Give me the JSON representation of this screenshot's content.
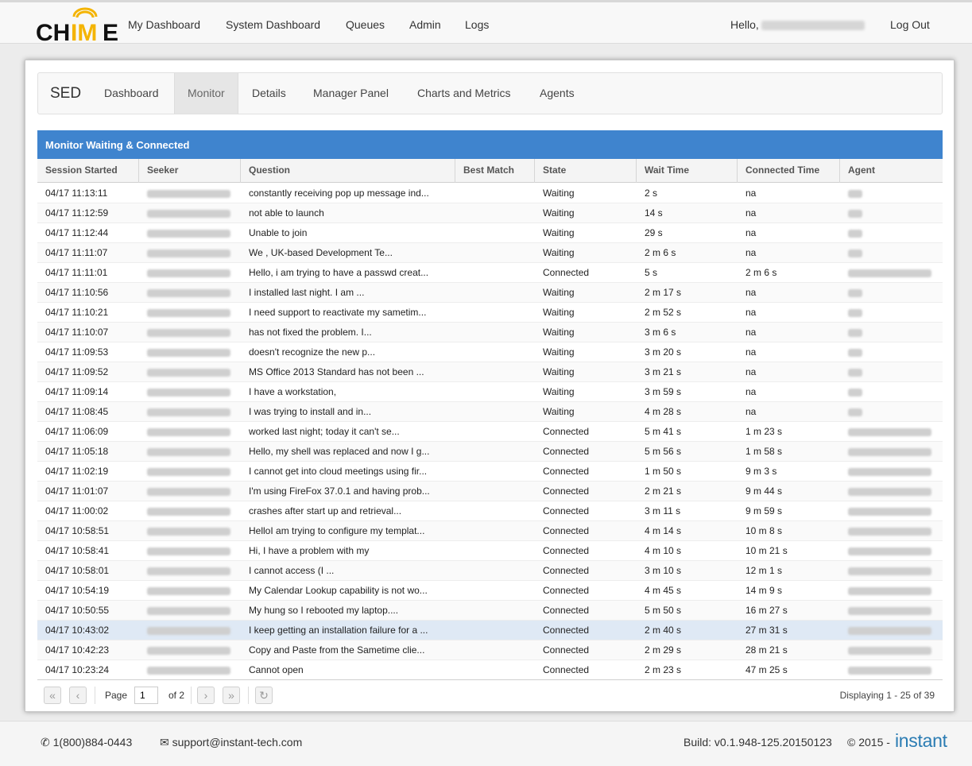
{
  "header": {
    "logo_text": "CHIME",
    "nav": [
      "My Dashboard",
      "System Dashboard",
      "Queues",
      "Admin",
      "Logs"
    ],
    "hello_label": "Hello,",
    "logout_label": "Log Out"
  },
  "subnav": {
    "brand": "SED",
    "tabs": [
      "Dashboard",
      "Monitor",
      "Details",
      "Manager Panel",
      "Charts and Metrics",
      "Agents"
    ],
    "active_tab": "Monitor"
  },
  "grid": {
    "title": "Monitor Waiting & Connected",
    "columns": [
      "Session Started",
      "Seeker",
      "Question",
      "Best Match",
      "State",
      "Wait Time",
      "Connected Time",
      "Agent"
    ],
    "rows": [
      {
        "started": "04/17 11:13:11",
        "question": "constantly receiving pop up message ind...",
        "best_match": "",
        "state": "Waiting",
        "wait": "2 s",
        "connected": "na"
      },
      {
        "started": "04/17 11:12:59",
        "question": "not able to launch",
        "best_match": "",
        "state": "Waiting",
        "wait": "14 s",
        "connected": "na"
      },
      {
        "started": "04/17 11:12:44",
        "question": "Unable to join",
        "best_match": "",
        "state": "Waiting",
        "wait": "29 s",
        "connected": "na"
      },
      {
        "started": "04/17 11:11:07",
        "question": "We , UK-based Development Te...",
        "best_match": "",
        "state": "Waiting",
        "wait": "2 m 6 s",
        "connected": "na"
      },
      {
        "started": "04/17 11:11:01",
        "question": "Hello, i am trying to have a passwd creat...",
        "best_match": "",
        "state": "Connected",
        "wait": "5 s",
        "connected": "2 m 6 s"
      },
      {
        "started": "04/17 11:10:56",
        "question": "I installed last night. I am ...",
        "best_match": "",
        "state": "Waiting",
        "wait": "2 m 17 s",
        "connected": "na"
      },
      {
        "started": "04/17 11:10:21",
        "question": "I need support to reactivate my sametim...",
        "best_match": "",
        "state": "Waiting",
        "wait": "2 m 52 s",
        "connected": "na"
      },
      {
        "started": "04/17 11:10:07",
        "question": "has not fixed the problem. I...",
        "best_match": "",
        "state": "Waiting",
        "wait": "3 m 6 s",
        "connected": "na"
      },
      {
        "started": "04/17 11:09:53",
        "question": "doesn't recognize the new p...",
        "best_match": "",
        "state": "Waiting",
        "wait": "3 m 20 s",
        "connected": "na"
      },
      {
        "started": "04/17 11:09:52",
        "question": "MS Office 2013 Standard has not been ...",
        "best_match": "",
        "state": "Waiting",
        "wait": "3 m 21 s",
        "connected": "na"
      },
      {
        "started": "04/17 11:09:14",
        "question": "I have a workstation,",
        "best_match": "",
        "state": "Waiting",
        "wait": "3 m 59 s",
        "connected": "na"
      },
      {
        "started": "04/17 11:08:45",
        "question": "I was trying to install and in...",
        "best_match": "",
        "state": "Waiting",
        "wait": "4 m 28 s",
        "connected": "na"
      },
      {
        "started": "04/17 11:06:09",
        "question": "worked last night; today it can't se...",
        "best_match": "",
        "state": "Connected",
        "wait": "5 m 41 s",
        "connected": "1 m 23 s"
      },
      {
        "started": "04/17 11:05:18",
        "question": "Hello, my shell was replaced and now I g...",
        "best_match": "",
        "state": "Connected",
        "wait": "5 m 56 s",
        "connected": "1 m 58 s"
      },
      {
        "started": "04/17 11:02:19",
        "question": "I cannot get into cloud meetings using fir...",
        "best_match": "",
        "state": "Connected",
        "wait": "1 m 50 s",
        "connected": "9 m 3 s"
      },
      {
        "started": "04/17 11:01:07",
        "question": "I'm using FireFox 37.0.1 and having prob...",
        "best_match": "",
        "state": "Connected",
        "wait": "2 m 21 s",
        "connected": "9 m 44 s"
      },
      {
        "started": "04/17 11:00:02",
        "question": "crashes after start up and retrieval...",
        "best_match": "",
        "state": "Connected",
        "wait": "3 m 11 s",
        "connected": "9 m 59 s"
      },
      {
        "started": "04/17 10:58:51",
        "question": "HelloI am trying to configure my templat...",
        "best_match": "",
        "state": "Connected",
        "wait": "4 m 14 s",
        "connected": "10 m 8 s"
      },
      {
        "started": "04/17 10:58:41",
        "question": "Hi, I have a problem with my",
        "best_match": "",
        "state": "Connected",
        "wait": "4 m 10 s",
        "connected": "10 m 21 s"
      },
      {
        "started": "04/17 10:58:01",
        "question": "I cannot access (I ...",
        "best_match": "",
        "state": "Connected",
        "wait": "3 m 10 s",
        "connected": "12 m 1 s"
      },
      {
        "started": "04/17 10:54:19",
        "question": "My Calendar Lookup capability is not wo...",
        "best_match": "",
        "state": "Connected",
        "wait": "4 m 45 s",
        "connected": "14 m 9 s"
      },
      {
        "started": "04/17 10:50:55",
        "question": "My hung so I rebooted my laptop....",
        "best_match": "",
        "state": "Connected",
        "wait": "5 m 50 s",
        "connected": "16 m 27 s"
      },
      {
        "started": "04/17 10:43:02",
        "question": "I keep getting an installation failure for a ...",
        "best_match": "",
        "state": "Connected",
        "wait": "2 m 40 s",
        "connected": "27 m 31 s"
      },
      {
        "started": "04/17 10:42:23",
        "question": "Copy and Paste from the Sametime clie...",
        "best_match": "",
        "state": "Connected",
        "wait": "2 m 29 s",
        "connected": "28 m 21 s"
      },
      {
        "started": "04/17 10:23:24",
        "question": "Cannot open",
        "best_match": "",
        "state": "Connected",
        "wait": "2 m 23 s",
        "connected": "47 m 25 s"
      }
    ],
    "selected_row": 22
  },
  "pager": {
    "page_label": "Page",
    "page_value": "1",
    "of_label": "of 2",
    "display": "Displaying 1 - 25 of 39"
  },
  "footer": {
    "phone": "1(800)884-0443",
    "email": "support@instant-tech.com",
    "build": "Build: v0.1.948-125.20150123",
    "copyright": "© 2015 -",
    "brand": "instant"
  },
  "colors": {
    "header_blue": "#3f84ce",
    "logo_yellow": "#f4b400",
    "brand_blue": "#2b7cb3"
  },
  "icons": {
    "phone": "phone-icon",
    "email": "envelope-icon",
    "first": "first-page-icon",
    "prev": "prev-page-icon",
    "next": "next-page-icon",
    "last": "last-page-icon",
    "refresh": "refresh-icon"
  }
}
